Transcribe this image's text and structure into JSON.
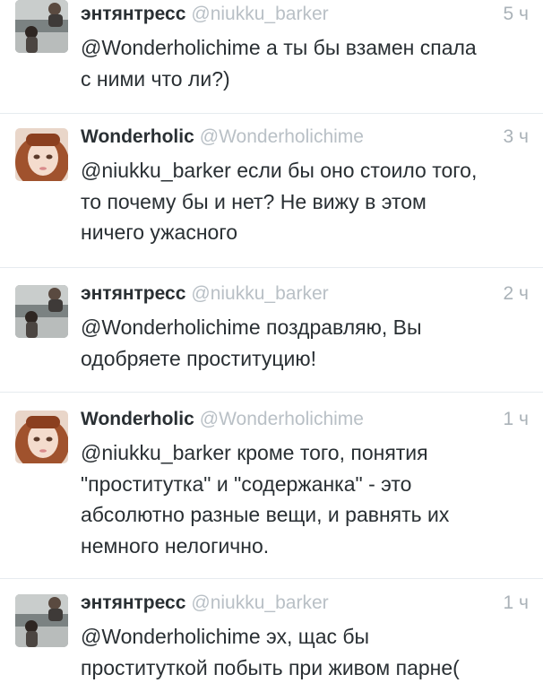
{
  "tweets": [
    {
      "name": "энтянтресс",
      "handle": "@niukku_barker",
      "time": "5 ч",
      "lines": [
        "@Wonderholichime а ты бы взамен спала",
        "с ними что ли?)"
      ],
      "avatar": "avatar-couple"
    },
    {
      "name": "Wonderholic",
      "handle": "@Wonderholichime",
      "time": "3 ч",
      "lines": [
        "@niukku_barker если бы оно стоило того,",
        "то почему бы и нет? Не вижу в этом",
        "ничего ужасного"
      ],
      "avatar": "avatar-girl"
    },
    {
      "name": "энтянтресс",
      "handle": "@niukku_barker",
      "time": "2 ч",
      "lines": [
        "@Wonderholichime поздравляю, Вы",
        "одобряете проституцию!"
      ],
      "avatar": "avatar-couple"
    },
    {
      "name": "Wonderholic",
      "handle": "@Wonderholichime",
      "time": "1 ч",
      "lines": [
        "@niukku_barker кроме того, понятия",
        "\"проститутка\" и \"содержанка\" - это",
        "абсолютно разные вещи, и равнять их",
        "немного нелогично."
      ],
      "avatar": "avatar-girl"
    },
    {
      "name": "энтянтресс",
      "handle": "@niukku_barker",
      "time": "1 ч",
      "lines": [
        "@Wonderholichime эх, щас бы",
        "проституткой побыть при живом парне("
      ],
      "avatar": "avatar-couple"
    }
  ]
}
